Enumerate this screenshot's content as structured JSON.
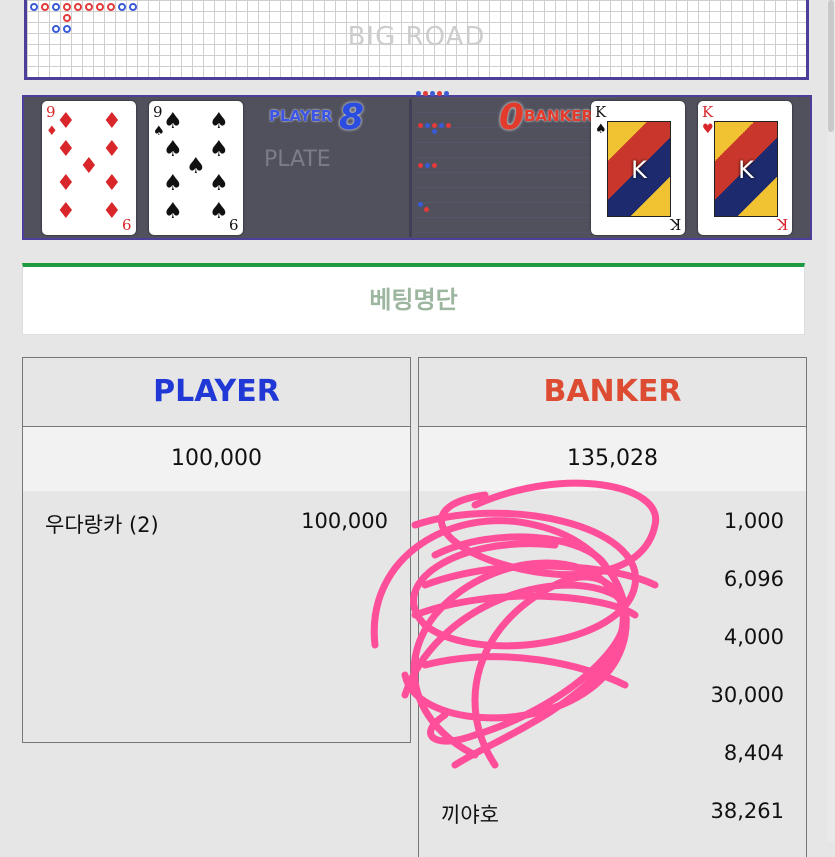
{
  "board": {
    "bigroad_label": "BIG ROAD",
    "ghost_label": "PLATE",
    "player_label": "PLAYER",
    "player_score": "8",
    "banker_label": "BANKER",
    "banker_score": "0",
    "player_cards": [
      {
        "rank": "9",
        "suit": "diamond",
        "suit_symbol": "♦"
      },
      {
        "rank": "9",
        "suit": "spade",
        "suit_symbol": "♠"
      }
    ],
    "banker_cards": [
      {
        "rank": "K",
        "suit": "spade",
        "suit_symbol": "♠"
      },
      {
        "rank": "K",
        "suit": "heart",
        "suit_symbol": "♥"
      }
    ]
  },
  "bet_list": {
    "title": "베팅명단"
  },
  "player": {
    "header": "PLAYER",
    "total": "100,000",
    "rows": [
      {
        "name": "우다랑카 (2)",
        "amount": "100,000"
      }
    ]
  },
  "banker": {
    "header": "BANKER",
    "total": "135,028",
    "rows": [
      {
        "name": "",
        "amount": "1,000"
      },
      {
        "name": "",
        "amount": "6,096"
      },
      {
        "name": "",
        "amount": "4,000"
      },
      {
        "name": "",
        "amount": "30,000"
      },
      {
        "name": "",
        "amount": "8,404"
      },
      {
        "name": "끼야호",
        "amount": "38,261"
      }
    ]
  },
  "colors": {
    "player": "#2039d6",
    "banker": "#dd4b33",
    "accent_green": "#1e9a43",
    "scribble": "#ff4f9a"
  }
}
